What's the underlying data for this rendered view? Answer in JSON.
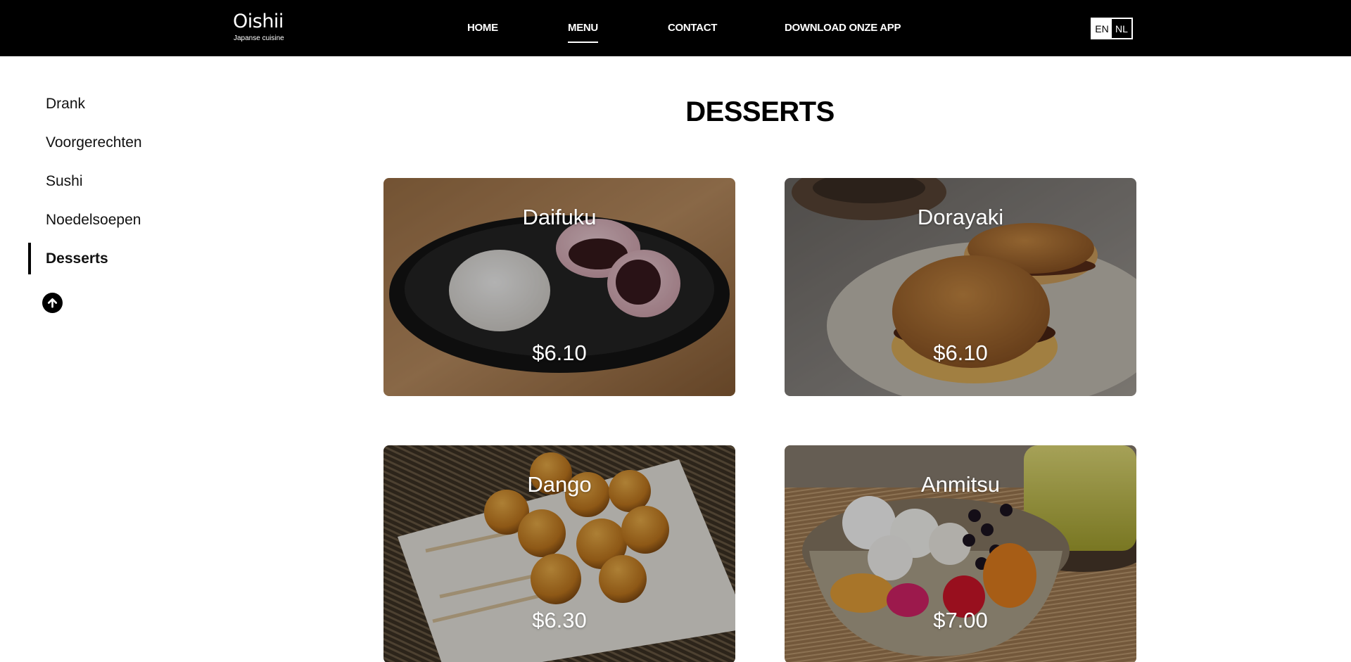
{
  "header": {
    "logo_name": "Oishii",
    "logo_sub": "Japanse cuisine",
    "nav": [
      {
        "label": "HOME"
      },
      {
        "label": "MENU",
        "active": true
      },
      {
        "label": "CONTACT"
      },
      {
        "label": "DOWNLOAD ONZE APP"
      }
    ],
    "languages": [
      {
        "label": "EN",
        "selected": true
      },
      {
        "label": "NL",
        "selected": false
      }
    ]
  },
  "sidebar": {
    "items": [
      {
        "label": "Drank"
      },
      {
        "label": "Voorgerechten"
      },
      {
        "label": "Sushi"
      },
      {
        "label": "Noedelsoepen"
      },
      {
        "label": "Desserts",
        "active": true
      }
    ],
    "scroll_top_icon": "arrow-up-circle-icon"
  },
  "main": {
    "title": "DESSERTS",
    "items": [
      {
        "name": "Daifuku",
        "price": "$6.10"
      },
      {
        "name": "Dorayaki",
        "price": "$6.10"
      },
      {
        "name": "Dango",
        "price": "$6.30"
      },
      {
        "name": "Anmitsu",
        "price": "$7.00"
      }
    ]
  },
  "colors": {
    "header_bg": "#000000",
    "page_bg": "#ffffff",
    "text": "#111111",
    "accent": "#ffffff"
  }
}
